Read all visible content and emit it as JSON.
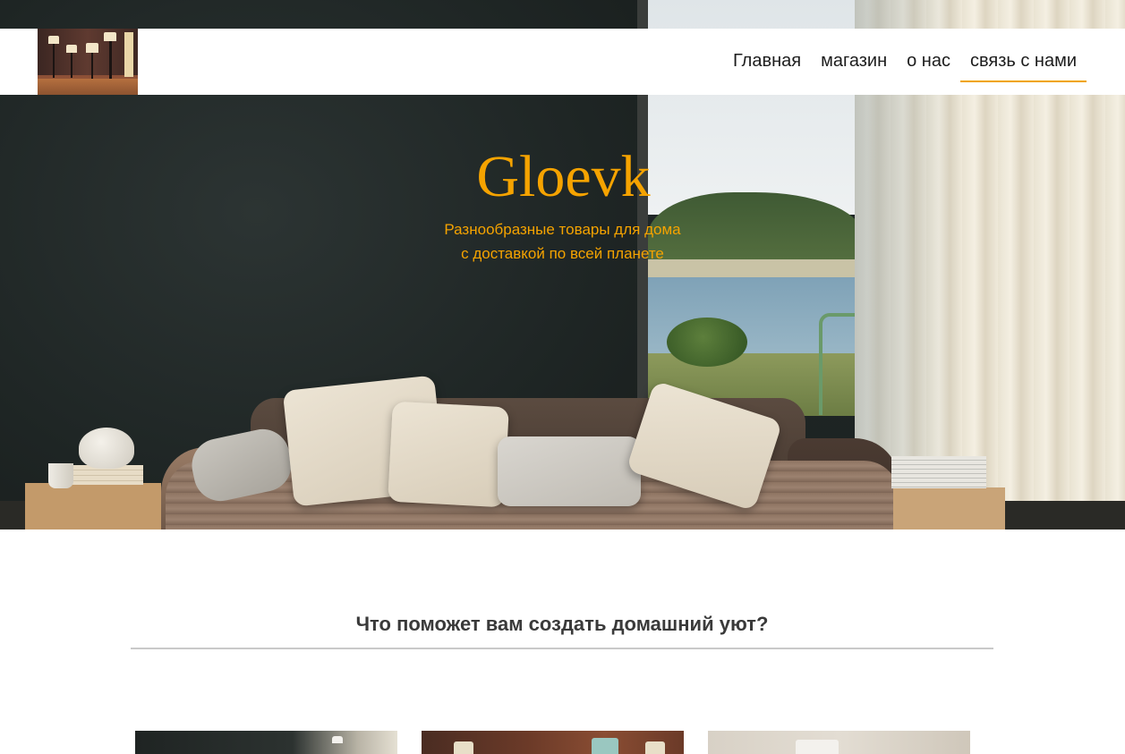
{
  "header": {
    "logo_alt": "lamps logo",
    "nav": [
      {
        "label": "Главная"
      },
      {
        "label": "магазин"
      },
      {
        "label": "о нас"
      },
      {
        "label": "связь с нами",
        "active": true
      }
    ]
  },
  "hero": {
    "title": "Gloevk",
    "subtitle_line1": "Разнообразные товары для дома",
    "subtitle_line2": "с доставкой по всей планете"
  },
  "section": {
    "heading": "Что поможет вам создать домашний уют?"
  },
  "colors": {
    "accent": "#f5a300",
    "header_bg": "#ffffff",
    "heading_text": "#3a3a3a",
    "divider": "#c9c9c9"
  }
}
